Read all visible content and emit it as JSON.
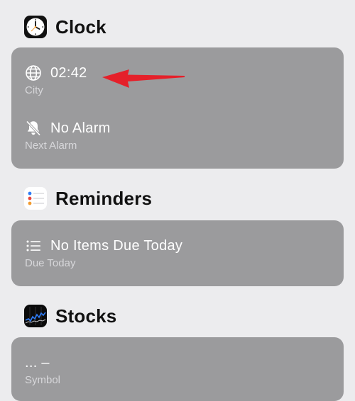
{
  "sections": {
    "clock": {
      "title": "Clock",
      "icon": "clock-app-icon",
      "rows": [
        {
          "value": "02:42",
          "label": "City",
          "icon": "globe-icon"
        },
        {
          "value": "No Alarm",
          "label": "Next Alarm",
          "icon": "bell-slash-icon"
        }
      ]
    },
    "reminders": {
      "title": "Reminders",
      "icon": "reminders-app-icon",
      "rows": [
        {
          "value": "No Items Due Today",
          "label": "Due Today",
          "icon": "list-icon"
        }
      ]
    },
    "stocks": {
      "title": "Stocks",
      "icon": "stocks-app-icon",
      "rows": [
        {
          "value": "... –",
          "label": "Symbol"
        }
      ]
    }
  },
  "colors": {
    "background": "#ececee",
    "card": "#9b9b9d",
    "value_text": "#ffffff",
    "label_text": "#d7d7da",
    "annotation_arrow": "#e5202a"
  }
}
